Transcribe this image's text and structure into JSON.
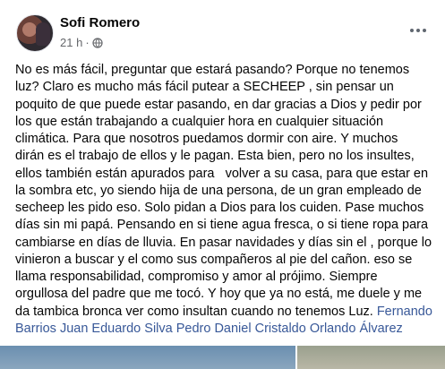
{
  "post": {
    "author": "Sofi Romero",
    "time": "21 h",
    "separator": "·",
    "privacy_icon": "globe-icon",
    "more_icon": "ellipsis-icon",
    "lines": [
      "No es más fácil, preguntar que estará pasando? Porque no tenemos",
      "luz? Claro es mucho más fácil putear a SECHEEP , sin pensar un",
      "poquito de que puede estar pasando, en dar gracias a Dios y pedir por",
      "los que están trabajando a cualquier hora en cualquier situación",
      "climática. Para que nosotros puedamos dormir con aire. Y muchos",
      "dirán es el trabajo de ellos y le pagan. Esta bien, pero no los insultes,",
      "ellos también están apurados para   volver a su casa, para que estar en",
      "la sombra etc, yo siendo hija de una persona, de un gran empleado de",
      "secheep les pido eso. Solo pidan a Dios para los cuiden. Pase muchos",
      "días sin mi papá. Pensando en si tiene agua fresca, o si tiene ropa para",
      "cambiarse en días de lluvia. En pasar navidades y días sin el , porque lo",
      "vinieron a buscar y el como sus compañeros al pie del cañon. eso se",
      "llama responsabilidad, compromiso y amor al prójimo. Siempre",
      "orgullosa del padre que me tocó. Y hoy que ya no está, me duele y me"
    ],
    "last_line_text": "da tambica bronca ver como insultan cuando no tenemos Luz. ",
    "mention_first": "Fernando",
    "mention_rest": "Barrios Juan Eduardo Silva Pedro Daniel Cristaldo Orlando Álvarez"
  }
}
